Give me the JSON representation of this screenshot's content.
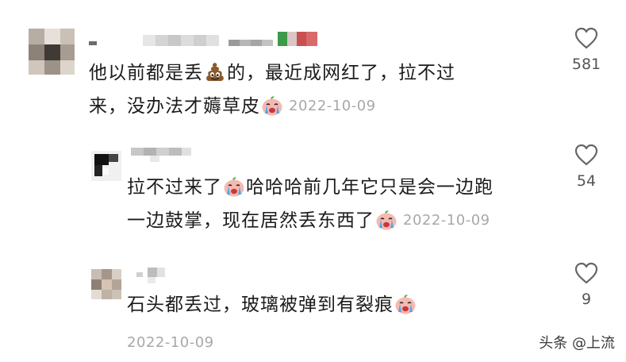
{
  "comments": [
    {
      "line1_a": "他以前都是丢",
      "line1_b": "的，最近成网红了，拉不过",
      "line2": "来，没办法才薅草皮",
      "date": "2022-10-09",
      "likes": "581"
    },
    {
      "line1_a": "拉不过来了",
      "line1_b": "哈哈哈前几年它只是会一边跑",
      "line2": "一边鼓掌，现在居然丢东西了",
      "date": "2022-10-09",
      "likes": "54"
    },
    {
      "line1": "石头都丢过，玻璃被弹到有裂痕",
      "date": "2022-10-09",
      "likes": "9"
    }
  ],
  "watermark": "头条 @上流",
  "colors": {
    "text": "#1b1b1b",
    "date": "#a8a8a8",
    "heart": "#666666",
    "emoji_face": "#f6b9b2",
    "emoji_tear": "#4aa9e8"
  },
  "icons": [
    "poop-emoji",
    "crying-face-emoji",
    "heart-icon"
  ]
}
